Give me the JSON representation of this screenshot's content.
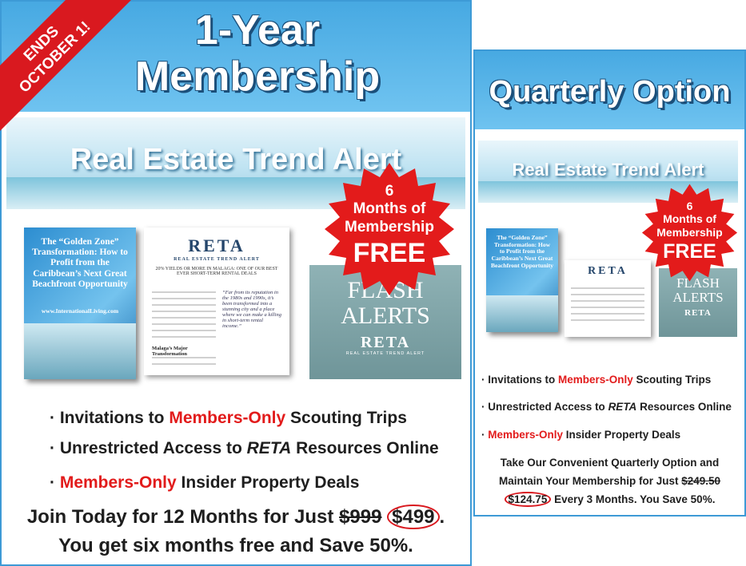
{
  "left": {
    "corner": {
      "line1": "ENDS",
      "line2": "OCTOBER 1!"
    },
    "title": {
      "line1": "1-Year",
      "line2": "Membership"
    },
    "banner": "Real Estate Trend Alert",
    "seal": {
      "l1": "6",
      "l2": "Months of",
      "l3": "Membership",
      "l4": "FREE"
    },
    "book": {
      "title": "The “Golden Zone” Transformation: How to Profit from the Caribbean’s Next Great Beachfront Opportunity",
      "url": "www.InternationalLiving.com"
    },
    "paper": {
      "name": "RETA",
      "sub": "REAL ESTATE TREND ALERT",
      "headline": "20% YIELDS OR MORE IN MALAGA: ONE OF OUR BEST EVER SHORT-TERM RENTAL DEALS",
      "pullquote": "“Far from its reputation in the 1980s and 1990s, it’s been transformed into a stunning city and a place where we can make a killing in short-term rental income.”",
      "subhead": "Malaga’s Major Transformation"
    },
    "flash": {
      "l1": "FLASH",
      "l2": "ALERTS",
      "brand": "RETA",
      "sub": "REAL ESTATE TREND ALERT"
    },
    "bullets": [
      {
        "pre": "Invitations to ",
        "red": "Members-Only",
        "post": " Scouting Trips"
      },
      {
        "pre": "Unrestricted Access to ",
        "ital": "RETA",
        "post": " Resources Online"
      },
      {
        "pre": "",
        "red": "Members-Only",
        "post": " Insider Property Deals"
      }
    ],
    "footer": {
      "pre": "Join Today for 12 Months for Just ",
      "old": "$999",
      "new": "$499",
      "end": ".",
      "line2": "You get six months free and Save 50%."
    }
  },
  "right": {
    "title": "Quarterly Option",
    "banner": "Real Estate Trend Alert",
    "seal": {
      "l1": "6",
      "l2": "Months of",
      "l3": "Membership",
      "l4": "FREE"
    },
    "flash": {
      "l1": "FLASH",
      "l2": "ALERTS",
      "brand": "RETA"
    },
    "paper": {
      "name": "RETA"
    },
    "bullets": [
      {
        "pre": "Invitations to ",
        "red": "Members-Only",
        "post": " Scouting Trips"
      },
      {
        "pre": "Unrestricted Access to ",
        "ital": "RETA",
        "post": " Resources Online"
      },
      {
        "pre": "",
        "red": "Members-Only",
        "post": " Insider Property Deals"
      }
    ],
    "footer": {
      "line1": "Take Our Convenient Quarterly Option and",
      "line2pre": "Maintain Your Membership for Just ",
      "old": "$249.50",
      "new": "$124.75",
      "line3post": " Every 3 Months. You Save 50%."
    }
  },
  "colors": {
    "accent_blue": "#47a9e2",
    "red": "#e21b1b",
    "flash_teal": "#7fa3a6"
  }
}
